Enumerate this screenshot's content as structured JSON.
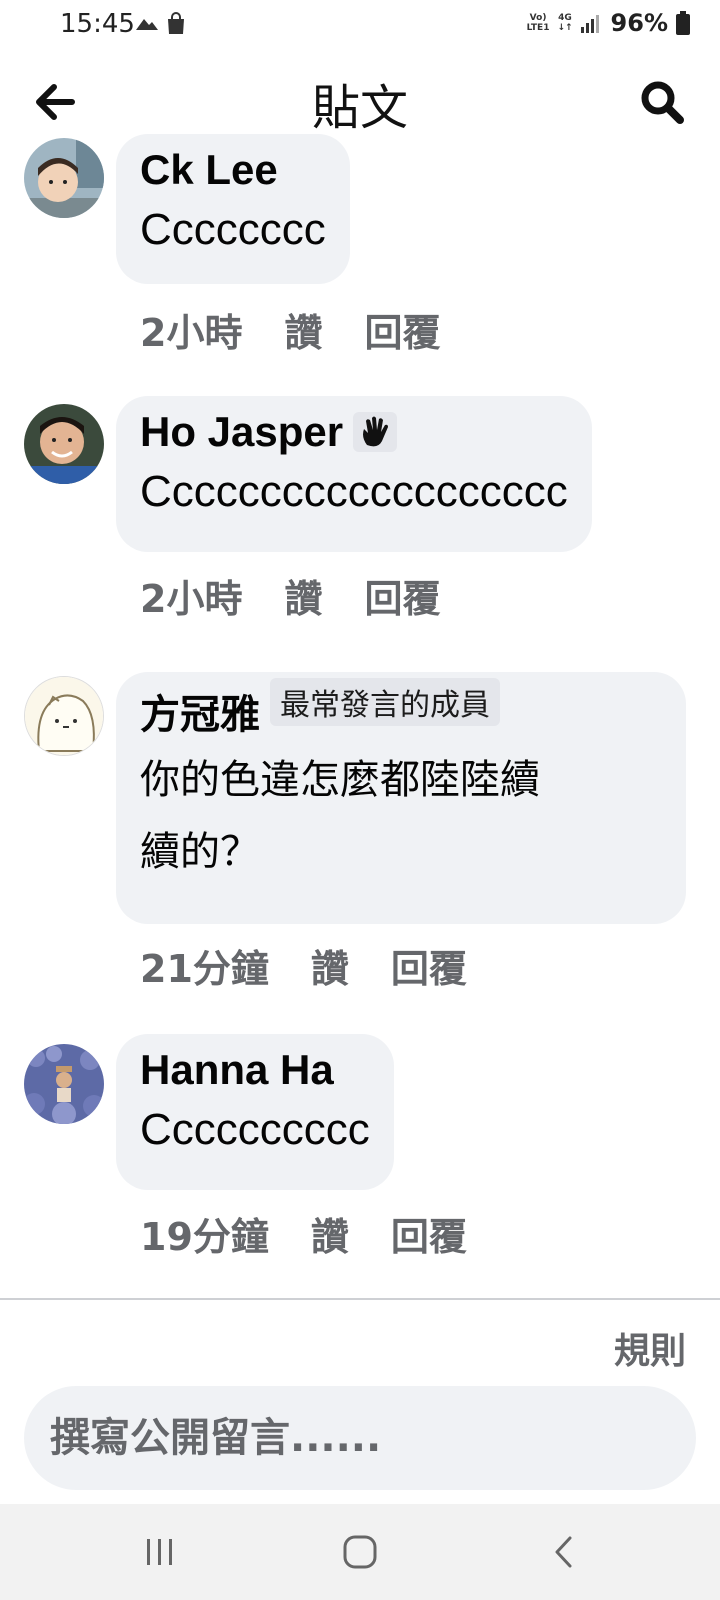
{
  "status_bar": {
    "time": "15:45",
    "network_top": "Vo)",
    "network_bottom": "LTE1",
    "net_type": "4G",
    "battery": "96%"
  },
  "header": {
    "title": "貼文"
  },
  "comments": [
    {
      "name": "Ck Lee",
      "text": "Cccccccc",
      "time": "2小時",
      "like": "讚",
      "reply": "回覆"
    },
    {
      "name": "Ho Jasper",
      "badge_icon": "wave-hand-icon",
      "text": "Ccccccccccccccccccc",
      "time": "2小時",
      "like": "讚",
      "reply": "回覆"
    },
    {
      "name": "方冠雅",
      "badge": "最常發言的成員",
      "text_line1": "你的色違怎麼都陸陸續",
      "text_line2": "續的？",
      "time": "21分鐘",
      "like": "讚",
      "reply": "回覆"
    },
    {
      "name": "Hanna Ha",
      "text": "Cccccccccc",
      "time": "19分鐘",
      "like": "讚",
      "reply": "回覆"
    }
  ],
  "footer": {
    "rules": "規則",
    "input_placeholder": "撰寫公開留言......"
  },
  "colors": {
    "bubble": "#f0f2f5",
    "meta_text": "#65676b",
    "nav_bar": "#f2f2f2"
  }
}
